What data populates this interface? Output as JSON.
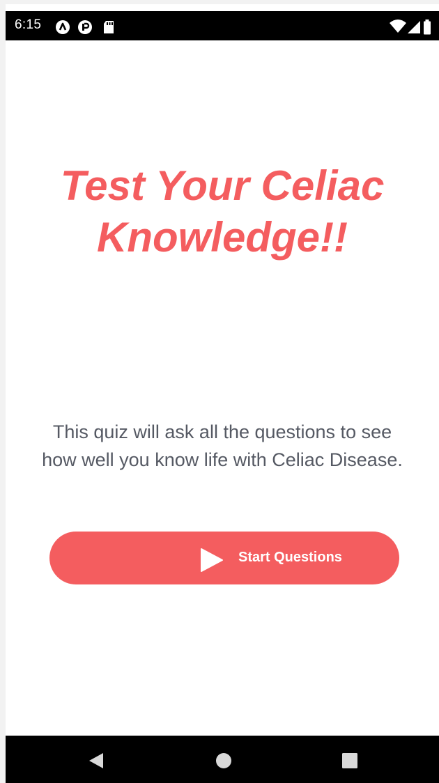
{
  "status_bar": {
    "time": "6:15",
    "notification_icons": [
      "app-a-icon",
      "app-r-icon",
      "sd-card-icon"
    ],
    "system_icons": [
      "wifi-icon",
      "signal-icon",
      "battery-icon"
    ]
  },
  "main": {
    "title_line1": "Test Your Celiac",
    "title_line2": "Knowledge!!",
    "description_line1": "This quiz will ask all the questions to see",
    "description_line2": "how well you know life with Celiac Disease.",
    "start_button": {
      "label": "Start Questions",
      "icon": "play-icon"
    }
  },
  "navigation_bar": {
    "buttons": [
      "back-icon",
      "home-icon",
      "recents-icon"
    ]
  },
  "colors": {
    "accent": "#f45d5f",
    "text_secondary": "#555963",
    "bars": "#000000",
    "background": "#ffffff"
  }
}
